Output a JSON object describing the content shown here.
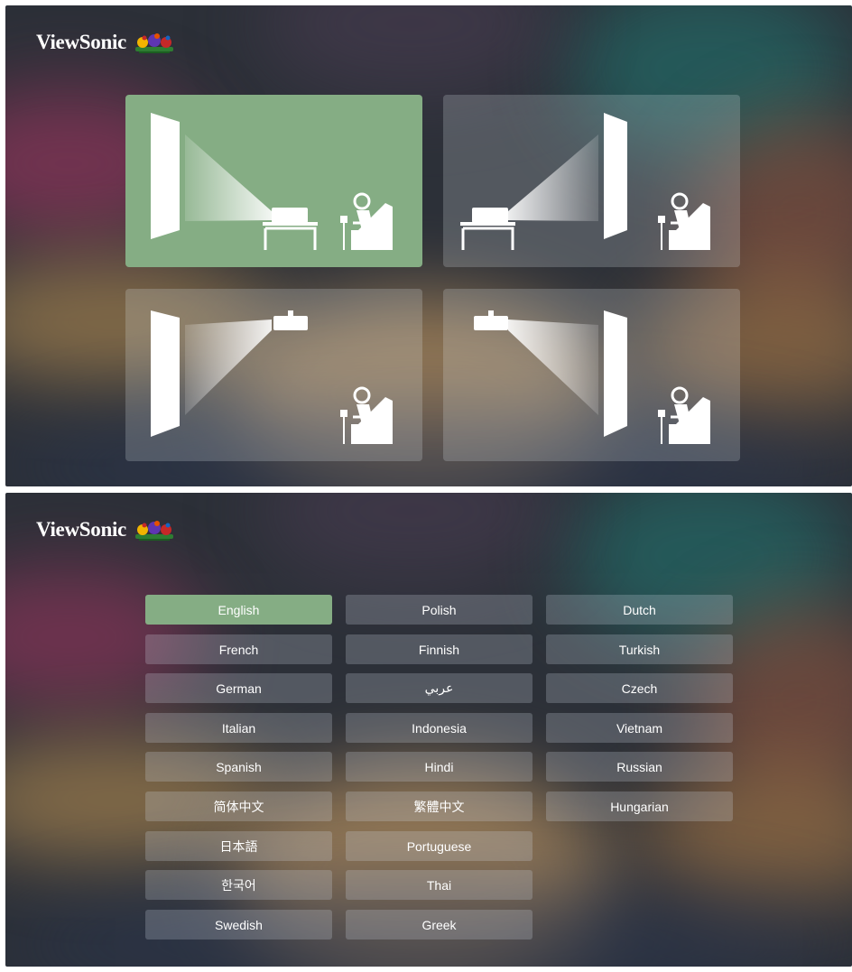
{
  "brand": {
    "name": "ViewSonic",
    "logo_icon": "viewsonic-birds-logo"
  },
  "colors": {
    "selected": "#85ad84",
    "tile": "rgba(225,230,238,0.22)",
    "text": "#ffffff"
  },
  "projection_setup": {
    "selected": "front-table",
    "options": [
      {
        "id": "front-table",
        "icon": "front-table-projection-icon",
        "selected": true
      },
      {
        "id": "rear-table",
        "icon": "rear-table-projection-icon",
        "selected": false
      },
      {
        "id": "front-ceiling",
        "icon": "front-ceiling-projection-icon",
        "selected": false
      },
      {
        "id": "rear-ceiling",
        "icon": "rear-ceiling-projection-icon",
        "selected": false
      }
    ]
  },
  "language_setup": {
    "selected": "English",
    "columns": [
      [
        "English",
        "French",
        "German",
        "Italian",
        "Spanish",
        "简体中文",
        "日本語",
        "한국어",
        "Swedish"
      ],
      [
        "Polish",
        "Finnish",
        "عربي",
        "Indonesia",
        "Hindi",
        "繁體中文",
        "Portuguese",
        "Thai",
        "Greek"
      ],
      [
        "Dutch",
        "Turkish",
        "Czech",
        "Vietnam",
        "Russian",
        "Hungarian"
      ]
    ]
  }
}
